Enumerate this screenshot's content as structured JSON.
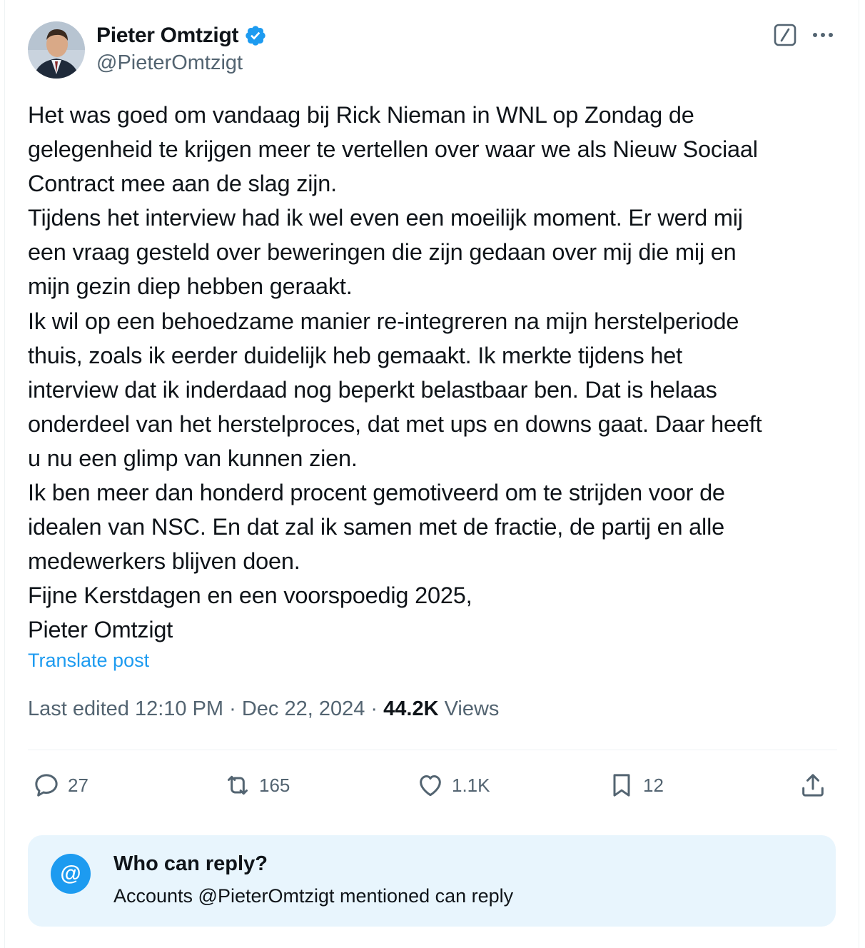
{
  "author": {
    "name": "Pieter Omtzigt",
    "handle": "@PieterOmtzigt"
  },
  "icons": {
    "verified": "verified-badge-icon",
    "grok": "grok-icon",
    "more": "more-icon"
  },
  "post": {
    "lines": [
      "Het was goed om vandaag bij Rick Nieman in WNL op Zondag de",
      "gelegenheid te krijgen meer te vertellen over waar we als Nieuw Sociaal",
      "Contract mee aan de slag zijn.",
      "Tijdens het interview had ik wel even een moeilijk moment. Er werd mij",
      "een vraag gesteld over beweringen die zijn gedaan over mij  die mij en",
      "mijn gezin diep hebben geraakt.",
      "Ik wil op een behoedzame manier re-integreren na mijn herstelperiode",
      "thuis, zoals ik eerder duidelijk heb gemaakt. Ik merkte tijdens het",
      "interview dat ik inderdaad nog beperkt belastbaar ben. Dat is helaas",
      "onderdeel van het herstelproces, dat met ups en downs gaat. Daar heeft",
      "u nu een glimp van kunnen zien.",
      "Ik ben meer dan honderd procent gemotiveerd om te strijden voor de",
      "idealen van NSC. En dat zal ik samen met de fractie, de partij en alle",
      "medewerkers blijven doen.",
      "Fijne Kerstdagen en een voorspoedig 2025,",
      "Pieter Omtzigt"
    ],
    "translate_label": "Translate post"
  },
  "meta": {
    "edited": "Last edited 12:10 PM · Dec 22, 2024 · ",
    "views_count": "44.2K",
    "views_label": " Views"
  },
  "actions": {
    "replies": "27",
    "reposts": "165",
    "likes": "1.1K",
    "bookmarks": "12"
  },
  "reply_settings": {
    "title": "Who can reply?",
    "subtitle": "Accounts @PieterOmtzigt mentioned can reply",
    "icon_glyph": "@"
  },
  "colors": {
    "accent": "#1d9bf0",
    "muted": "#536471",
    "text": "#0f1419",
    "reply_box_bg": "#e8f5fd"
  }
}
